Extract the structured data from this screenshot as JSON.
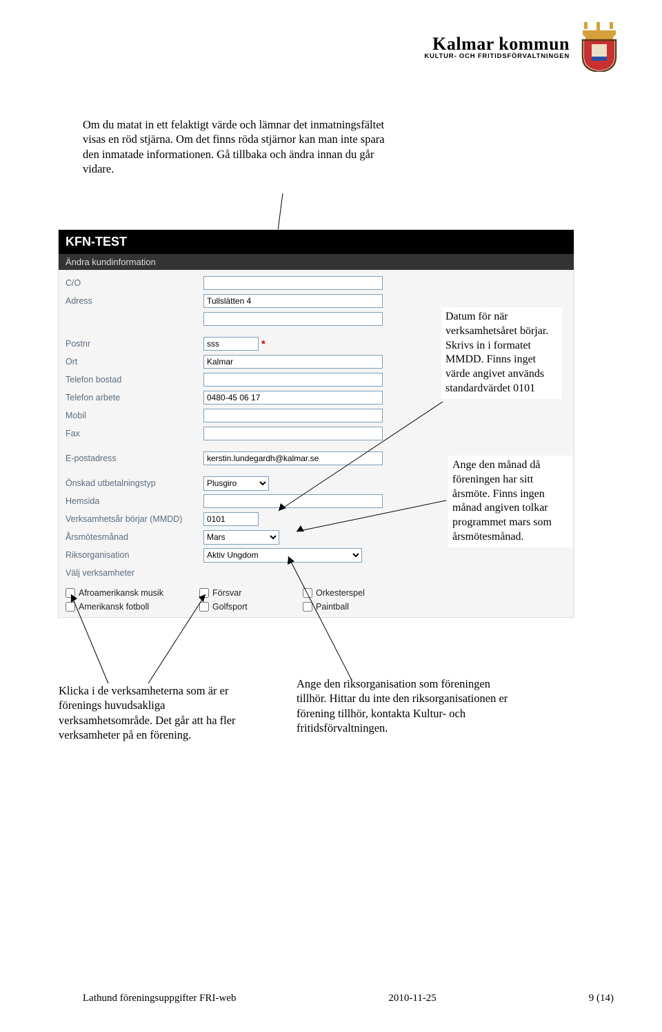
{
  "logo": {
    "line1": "Kalmar kommun",
    "line2": "KULTUR- OCH FRITIDSFÖRVALTNINGEN"
  },
  "top_annotation": "Om du matat in ett felaktigt värde och lämnar det inmatningsfältet visas en röd stjärna. Om det finns röda stjärnor kan man inte spara den inmatade informationen. Gå tillbaka och ändra innan du går vidare.",
  "app": {
    "titlebar": "KFN-TEST",
    "subtitle": "Ändra kundinformation",
    "fields": {
      "co": {
        "label": "C/O",
        "value": ""
      },
      "adress": {
        "label": "Adress",
        "value": "Tullslätten 4",
        "value2": ""
      },
      "postnr": {
        "label": "Postnr",
        "value": "sss",
        "invalid": true
      },
      "ort": {
        "label": "Ort",
        "value": "Kalmar"
      },
      "tel_bostad": {
        "label": "Telefon bostad",
        "value": ""
      },
      "tel_arbete": {
        "label": "Telefon arbete",
        "value": "0480-45 06 17"
      },
      "mobil": {
        "label": "Mobil",
        "value": ""
      },
      "fax": {
        "label": "Fax",
        "value": ""
      },
      "epost": {
        "label": "E-postadress",
        "value": "kerstin.lundegardh@kalmar.se"
      },
      "utbet": {
        "label": "Önskad utbetalningstyp",
        "value": "Plusgiro"
      },
      "hemsida": {
        "label": "Hemsida",
        "value": ""
      },
      "verksar": {
        "label": "Verksamhetsår börjar (MMDD)",
        "value": "0101"
      },
      "arsmote": {
        "label": "Årsmötesmånad",
        "value": "Mars"
      },
      "riksorg": {
        "label": "Riksorganisation",
        "value": "Aktiv Ungdom"
      },
      "valjverk": {
        "label": "Välj verksamheter"
      }
    },
    "checkboxes": {
      "row1": [
        "Afroamerikansk musik",
        "Försvar",
        "Orkesterspel"
      ],
      "row2": [
        "Amerikansk fotboll",
        "Golfsport",
        "Paintball"
      ]
    }
  },
  "callout_datum": "Datum för när verksamhetsåret börjar. Skrivs in i formatet MMDD. Finns inget värde angivet används standardvärdet 0101",
  "callout_arsmote": "Ange den månad då föreningen har sitt årsmöte. Finns ingen månad angiven tolkar programmet mars som årsmötesmånad.",
  "bottom_left": "Klicka i de verksamheterna som är er förenings huvudsakliga verksamhetsområde. Det går att ha fler verksamheter på en förening.",
  "bottom_right": "Ange den riksorganisation som föreningen tillhör. Hittar du inte den riksorganisationen er förening tillhör, kontakta Kultur- och fritidsförvaltningen.",
  "footer": {
    "left": "Lathund föreningsuppgifter FRI-web",
    "mid": "2010-11-25",
    "right": "9 (14)"
  }
}
